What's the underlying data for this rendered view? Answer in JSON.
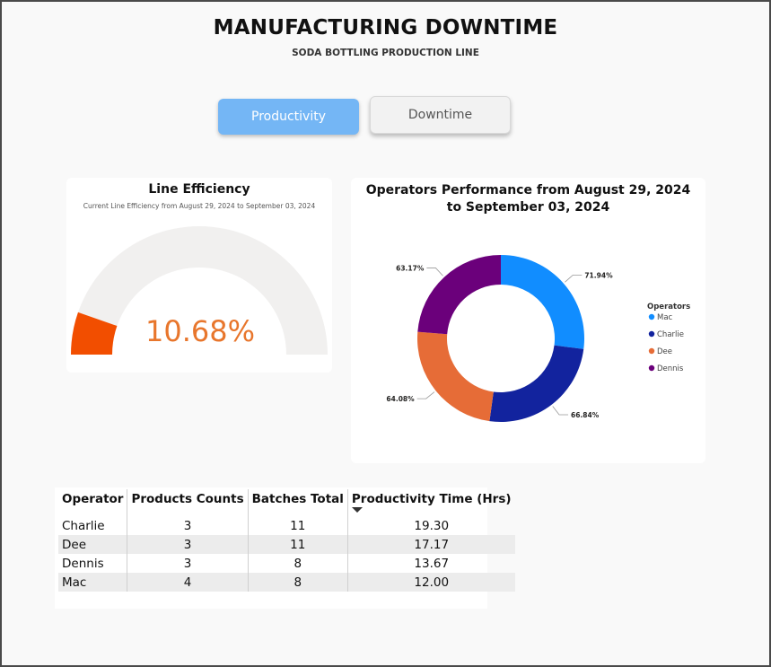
{
  "header": {
    "title": "MANUFACTURING DOWNTIME",
    "subtitle": "SODA BOTTLING PRODUCTION LINE"
  },
  "nav": {
    "productivity_label": "Productivity",
    "downtime_label": "Downtime",
    "active": "Productivity"
  },
  "colors": {
    "accent_button": "#74b6f5",
    "gauge_fill": "#f24e00",
    "gauge_track": "#f1f0ef",
    "gauge_value_text": "#e8762c"
  },
  "gauge": {
    "title": "Line Efficiency",
    "subtitle": "Current Line Efficiency from August 29, 2024 to September 03, 2024",
    "value_label": "10.68%"
  },
  "chart_data": [
    {
      "type": "gauge",
      "title": "Line Efficiency",
      "subtitle": "Current Line Efficiency from August 29, 2024 to September 03, 2024",
      "value": 10.68,
      "min": 0,
      "max": 100,
      "unit": "%"
    },
    {
      "type": "donut",
      "title": "Operators Performance from August 29, 2024 to September 03, 2024",
      "legend_title": "Operators",
      "legend_position": "right",
      "categories": [
        "Mac",
        "Charlie",
        "Dee",
        "Dennis"
      ],
      "values": [
        71.94,
        66.84,
        64.08,
        63.17
      ],
      "labels": [
        "71.94%",
        "66.84%",
        "64.08%",
        "63.17%"
      ],
      "colors": [
        "#118dff",
        "#12239e",
        "#e66c37",
        "#6b007b"
      ]
    }
  ],
  "table": {
    "headers": [
      "Operator",
      "Products Counts",
      "Batches Total",
      "Productivity Time (Hrs)"
    ],
    "sorted_column": "Productivity Time (Hrs)",
    "rows": [
      [
        "Charlie",
        "3",
        "11",
        "19.30"
      ],
      [
        "Dee",
        "3",
        "11",
        "17.17"
      ],
      [
        "Dennis",
        "3",
        "8",
        "13.67"
      ],
      [
        "Mac",
        "4",
        "8",
        "12.00"
      ]
    ]
  }
}
